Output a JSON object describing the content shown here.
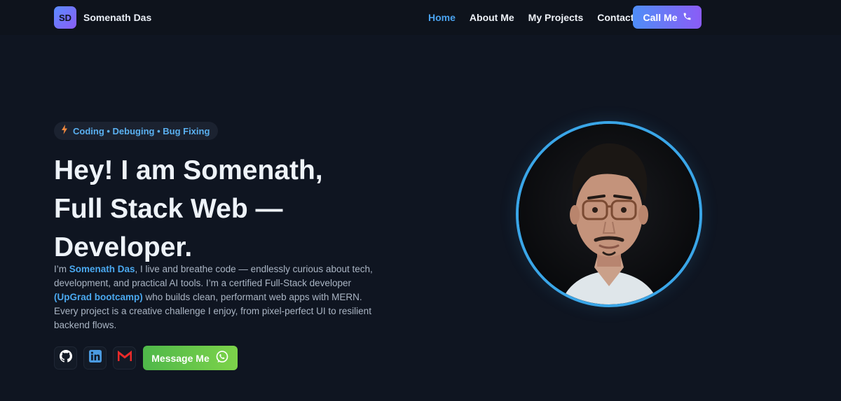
{
  "brand": {
    "initials": "SD",
    "name": "Somenath Das"
  },
  "nav": {
    "items": [
      {
        "label": "Home",
        "active": true
      },
      {
        "label": "About Me",
        "active": false
      },
      {
        "label": "My Projects",
        "active": false
      },
      {
        "label": "Contact",
        "active": false
      }
    ],
    "cta_label": "Call Me"
  },
  "hero": {
    "badge": "Coding • Debuging • Bug Fixing",
    "title_lines": [
      "Hey! I am Somenath,",
      "Full Stack Web —",
      "Developer."
    ],
    "desc": {
      "p1": "I’m ",
      "name": "Somenath Das",
      "p2": ", I live and breathe code — endlessly curious about tech, development, and practical AI tools. I’m a certified Full-Stack developer ",
      "bootcamp": "(UpGrad bootcamp)",
      "p3": " who builds clean, performant web apps with MERN. Every project is a creative challenge I enjoy, from pixel-perfect UI to resilient backend flows."
    },
    "message_label": "Message Me"
  },
  "socials": [
    "github-icon",
    "linkedin-icon",
    "gmail-icon"
  ],
  "colors": {
    "background": "#0f1521",
    "accent": "#4aa3f0",
    "cta_gradient": [
      "#4f8ef7",
      "#8b5cf6"
    ],
    "message_gradient": [
      "#4fb84a",
      "#7dd34a"
    ]
  }
}
